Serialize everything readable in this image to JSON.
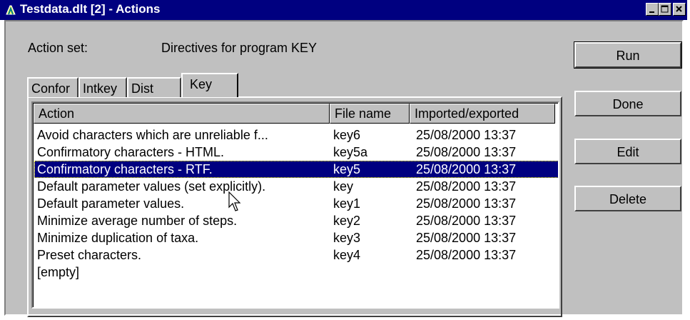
{
  "window": {
    "title": "Testdata.dlt [2] - Actions",
    "buttons": [
      "_",
      "□",
      "×"
    ]
  },
  "action_set": {
    "label": "Action set:",
    "value": "Directives for program KEY"
  },
  "tabs": [
    {
      "label": "Confor"
    },
    {
      "label": "Intkey"
    },
    {
      "label": "Dist"
    },
    {
      "label": "Key",
      "active": true
    }
  ],
  "list": {
    "columns": [
      "Action",
      "File name",
      "Imported/exported"
    ],
    "rows": [
      {
        "action": "Avoid characters which are unreliable f...",
        "file": "key6",
        "date": "25/08/2000 13:37"
      },
      {
        "action": "Confirmatory characters - HTML.",
        "file": "key5a",
        "date": "25/08/2000 13:37"
      },
      {
        "action": "Confirmatory characters - RTF.",
        "file": "key5",
        "date": "25/08/2000 13:37",
        "selected": true
      },
      {
        "action": "Default parameter values (set explicitly).",
        "file": "key",
        "date": "25/08/2000 13:37"
      },
      {
        "action": "Default parameter values.",
        "file": "key1",
        "date": "25/08/2000 13:37"
      },
      {
        "action": "Minimize average number of steps.",
        "file": "key2",
        "date": "25/08/2000 13:37"
      },
      {
        "action": "Minimize duplication of taxa.",
        "file": "key3",
        "date": "25/08/2000 13:37"
      },
      {
        "action": "Preset characters.",
        "file": "key4",
        "date": "25/08/2000 13:37"
      },
      {
        "action": "[empty]",
        "file": "",
        "date": ""
      }
    ]
  },
  "buttons": {
    "run": "Run",
    "done": "Done",
    "edit": "Edit",
    "delete": "Delete"
  },
  "colors": {
    "titlebar": "#000080",
    "face": "#c0c0c0",
    "selection": "#000080"
  }
}
